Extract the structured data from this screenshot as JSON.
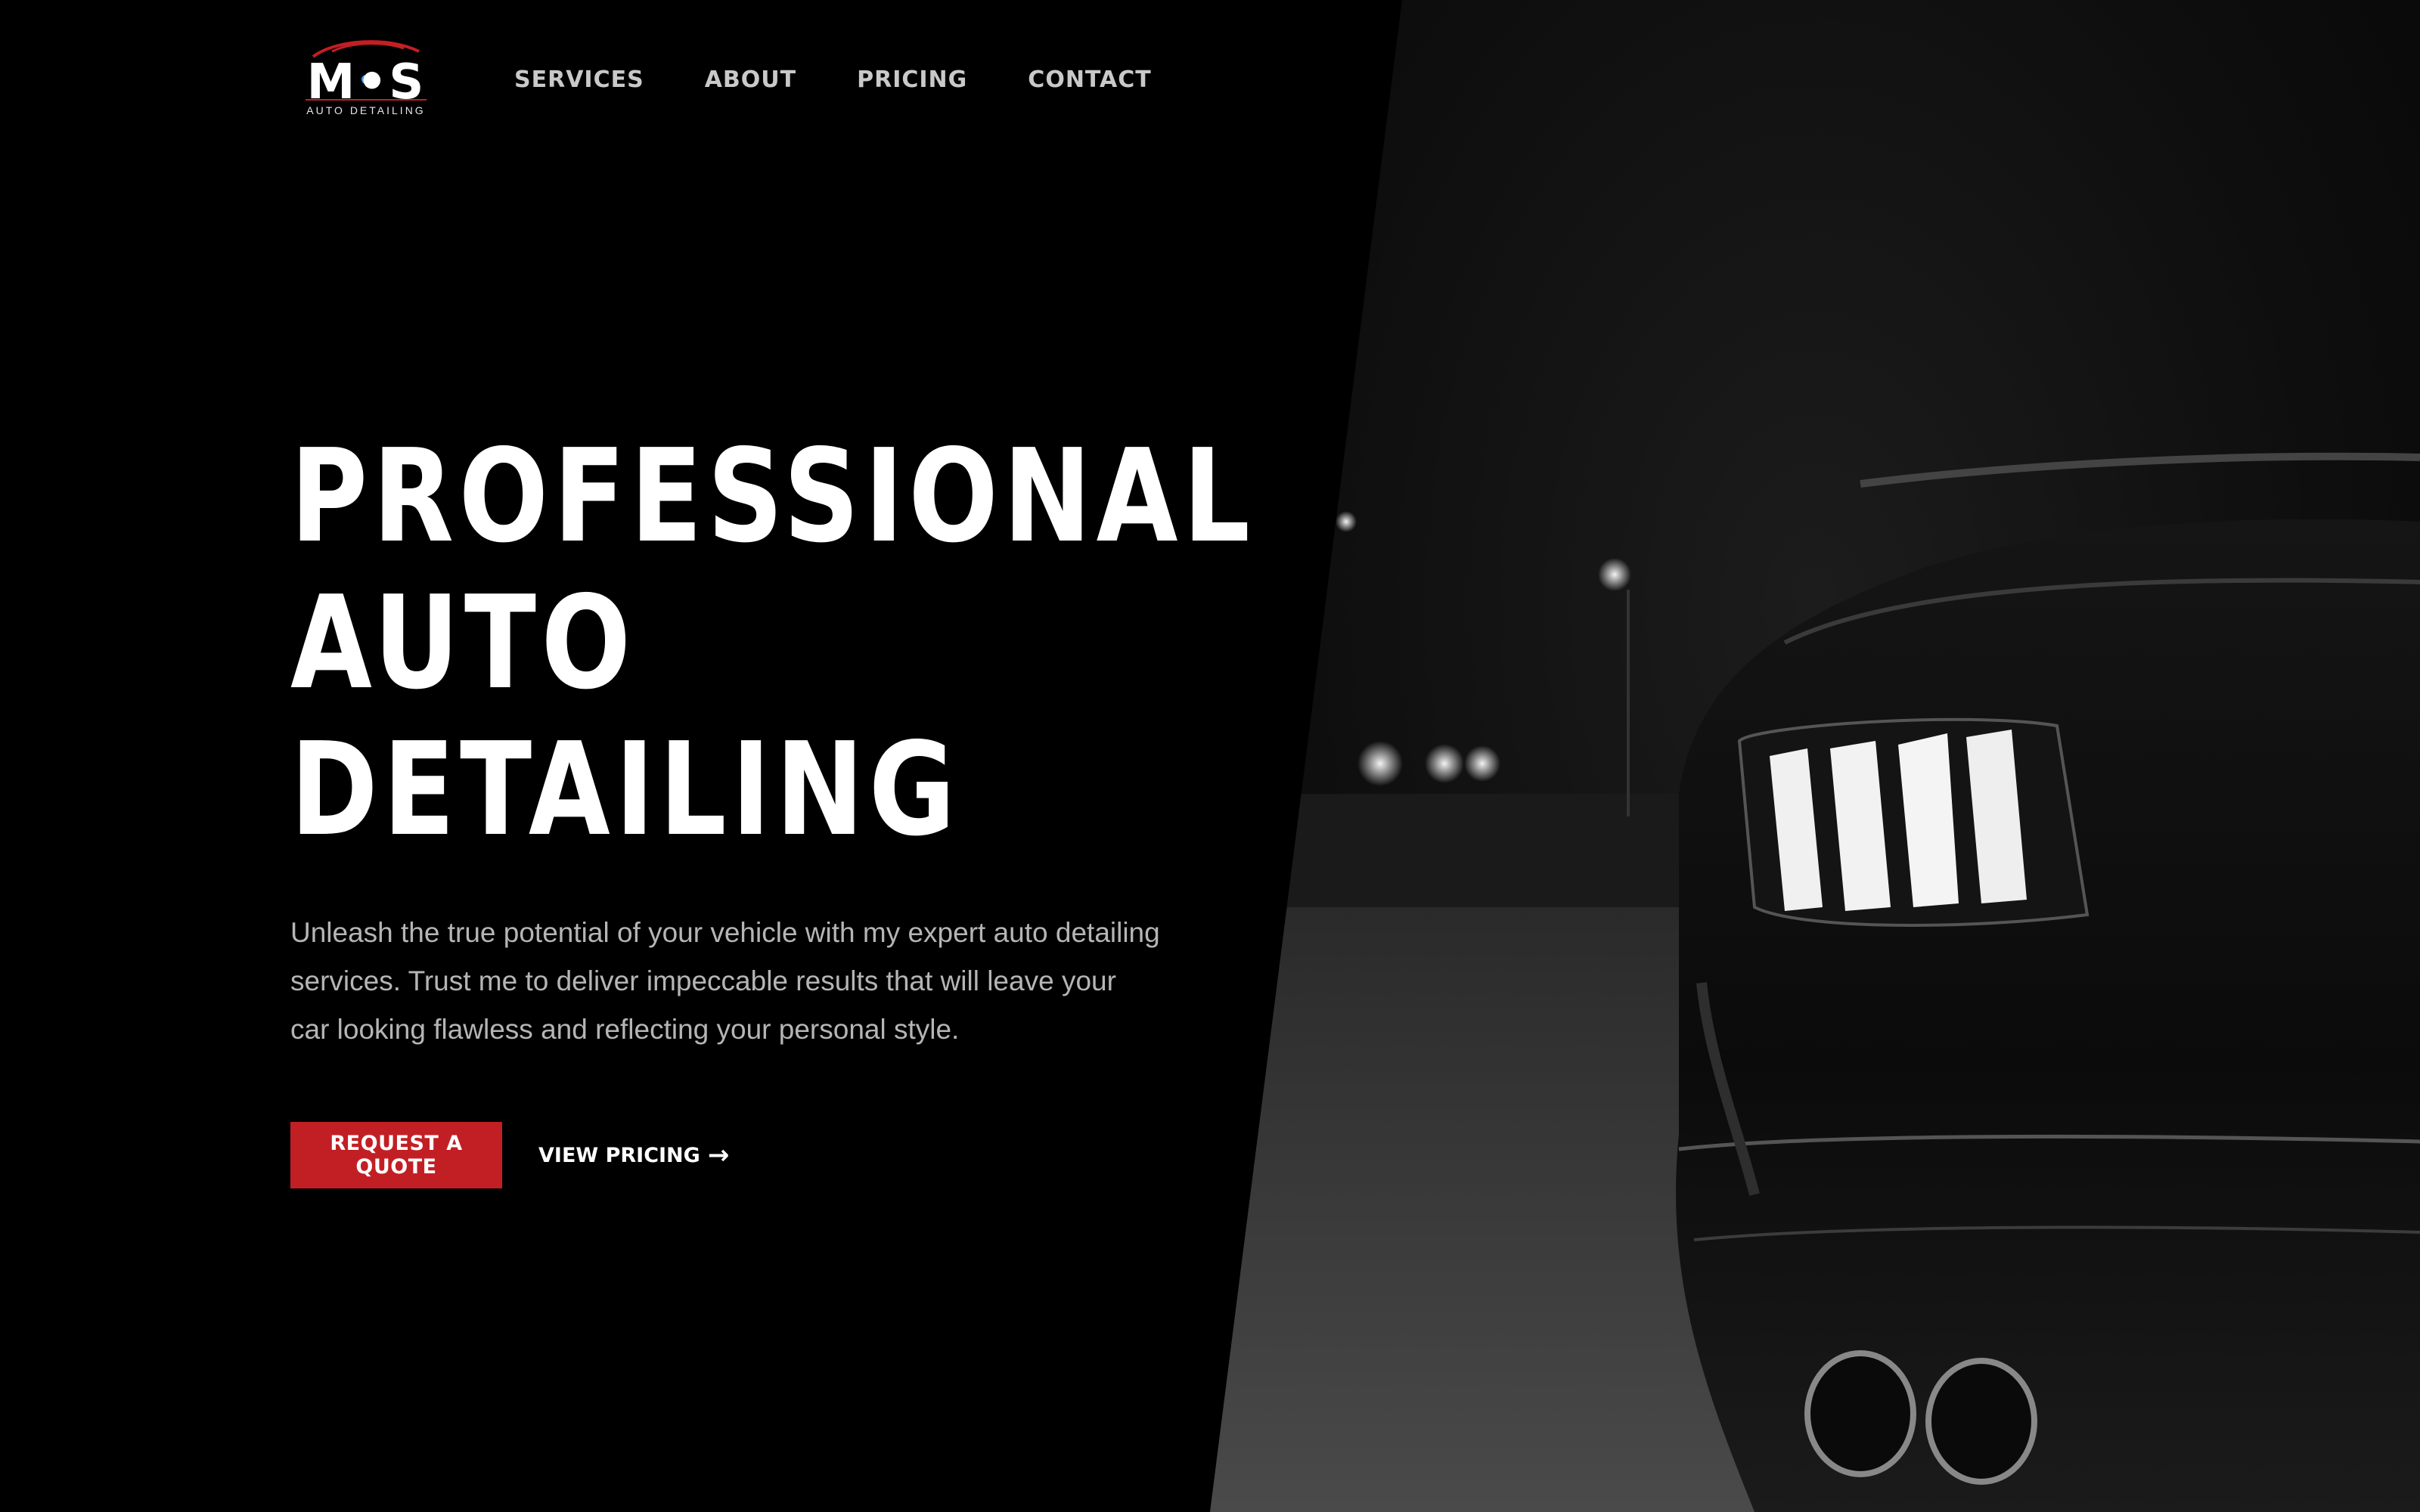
{
  "brand": {
    "logo_text": "M•S",
    "logo_subtitle": "AUTO DETAILING",
    "accent_color": "#c21f24"
  },
  "nav": {
    "items": [
      {
        "label": "SERVICES"
      },
      {
        "label": "ABOUT"
      },
      {
        "label": "PRICING"
      },
      {
        "label": "CONTACT"
      }
    ]
  },
  "hero": {
    "title_lines": [
      "PROFESSIONAL",
      "AUTO",
      "DETAILING"
    ],
    "description": "Unleash the true potential of your vehicle with my expert auto detailing services. Trust me to deliver impeccable results that will leave your car looking flawless and reflecting your personal style.",
    "primary_cta": "REQUEST A QUOTE",
    "secondary_cta": "VIEW PRICING",
    "secondary_cta_icon": "arrow-right-icon"
  },
  "image": {
    "description_icon": "car-photo"
  }
}
